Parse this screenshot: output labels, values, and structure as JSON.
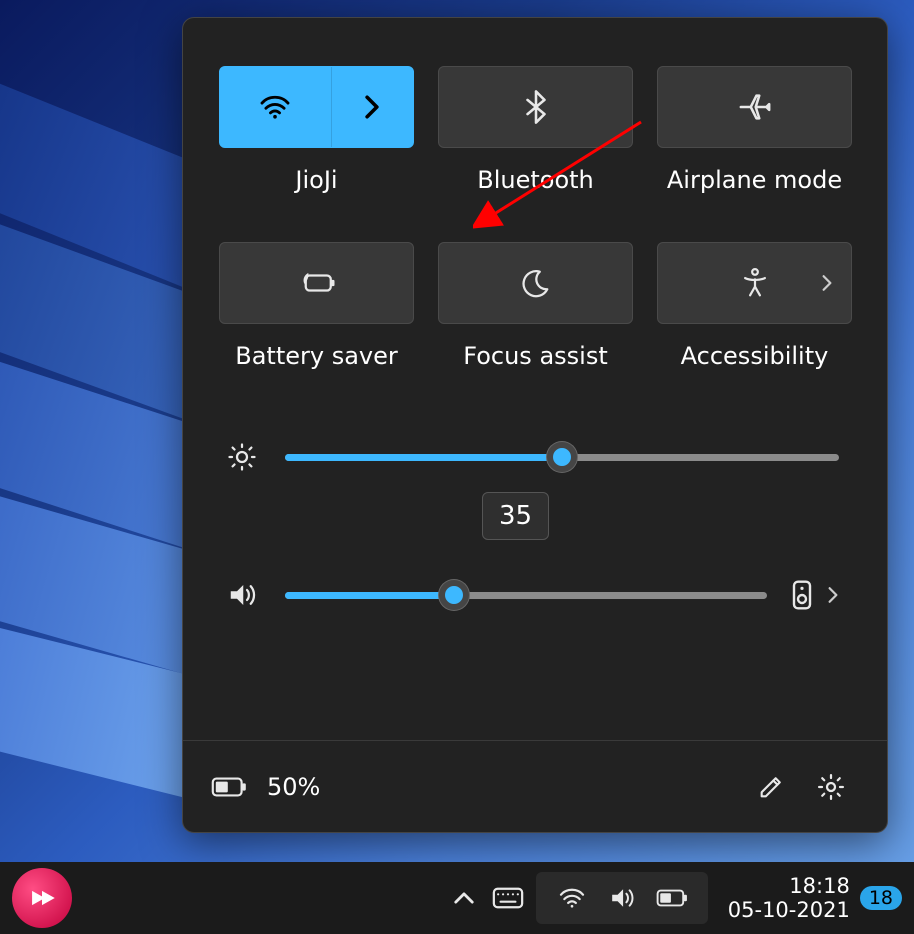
{
  "panel": {
    "tiles": [
      {
        "label": "JioJi",
        "active": true,
        "split": true,
        "icon": "wifi",
        "arrow": true
      },
      {
        "label": "Bluetooth",
        "active": false,
        "icon": "bluetooth"
      },
      {
        "label": "Airplane mode",
        "active": false,
        "icon": "airplane"
      },
      {
        "label": "Battery saver",
        "active": false,
        "icon": "battery-saver"
      },
      {
        "label": "Focus assist",
        "active": false,
        "icon": "moon"
      },
      {
        "label": "Accessibility",
        "active": false,
        "icon": "accessibility",
        "sub_arrow": true
      }
    ],
    "brightness": {
      "value": 50,
      "tooltip": "35"
    },
    "volume": {
      "value": 35
    },
    "battery_text": "50%"
  },
  "taskbar": {
    "time": "18:18",
    "date": "05-10-2021",
    "notification_count": "18"
  }
}
